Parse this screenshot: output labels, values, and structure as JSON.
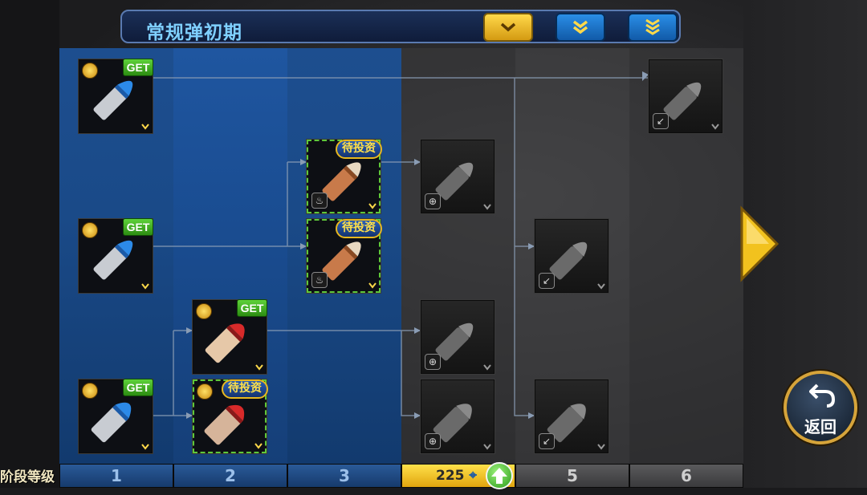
{
  "header": {
    "title": "常规弹初期"
  },
  "badges": {
    "get": "GET",
    "pending": "待投资"
  },
  "footer": {
    "label": "阶段等级",
    "stages": [
      "1",
      "2",
      "3",
      "225",
      "5",
      "6"
    ]
  },
  "back_button": {
    "label": "返回"
  },
  "colors": {
    "accent_gold": "#e0a40e",
    "column_blue": "#1a4a88",
    "get_green": "#3aa81c",
    "pending_text": "#ffe04a"
  }
}
